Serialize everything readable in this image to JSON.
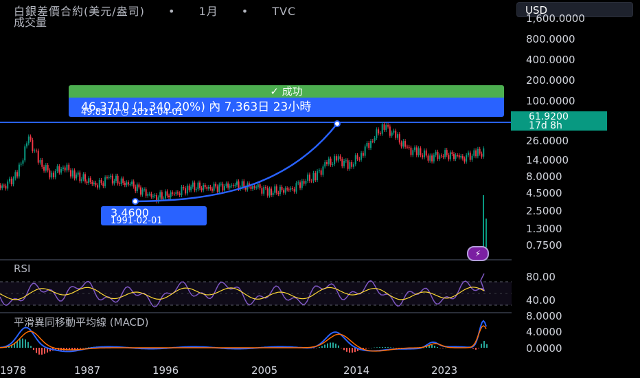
{
  "header": {
    "symbol": "白銀差價合約(美元/盎司)",
    "sep1": "•",
    "interval": "1月",
    "sep2": "•",
    "source": "TVC",
    "volume_label": "成交量"
  },
  "currency": "USD",
  "price_axis": [
    "1,600.0000",
    "800.0000",
    "400.0000",
    "200.0000",
    "100.0000",
    "26.0000",
    "14.0000",
    "8.0000",
    "4.5000",
    "2.5000",
    "1.3000",
    "0.7500"
  ],
  "current_price": {
    "value": "61.9200",
    "countdown": "17d 8h"
  },
  "time_axis": [
    "1978",
    "1987",
    "1996",
    "2005",
    "2014",
    "2023"
  ],
  "measure_tool": {
    "status": "✓ 成功",
    "line1": "46.3710 (1,340.20%) 內 7,363日 23小時",
    "line2_price": "49.8310",
    "line2_date": "2011-04-01",
    "clock_icon": "clock-icon"
  },
  "low_label": {
    "price": "3.4600",
    "date": "1991-02-01"
  },
  "rsi": {
    "label": "RSI",
    "axis": [
      "80.00",
      "40.00"
    ]
  },
  "macd": {
    "label": "平滑異同移動平均線 (MACD)",
    "axis": [
      "8.0000",
      "4.0000",
      "0.0000"
    ]
  },
  "colors": {
    "up": "#089981",
    "down": "#f23645",
    "measure": "#2962ff",
    "success": "#4caf50",
    "rsi": "#7e57c2",
    "rsi_ma": "#fdd835",
    "macd": "#2962ff",
    "signal": "#ff6d00"
  },
  "chart_data": {
    "type": "line",
    "title": "白銀差價合約(美元/盎司)",
    "yscale": "log",
    "x": [
      1976,
      1978,
      1979,
      1980,
      1981,
      1982,
      1983,
      1984,
      1986,
      1987,
      1989,
      1991,
      1993,
      1994,
      1996,
      1998,
      2000,
      2001,
      2003,
      2004,
      2005,
      2006,
      2007,
      2008,
      2009,
      2010,
      2011,
      2012,
      2013,
      2014,
      2015,
      2016,
      2018,
      2019,
      2020,
      2021,
      2022,
      2023,
      2024,
      2025
    ],
    "series": [
      {
        "values": [
          4.5,
          5.5,
          8,
          30,
          12,
          8,
          11,
          8,
          5.5,
          7,
          5.5,
          3.46,
          4.2,
          5.2,
          5.0,
          5.5,
          5.0,
          4.3,
          4.8,
          6.5,
          7.5,
          12,
          14,
          11,
          17,
          30,
          47,
          32,
          20,
          18,
          15,
          17,
          15,
          17,
          19,
          25,
          21,
          23,
          29,
          62
        ]
      }
    ]
  }
}
